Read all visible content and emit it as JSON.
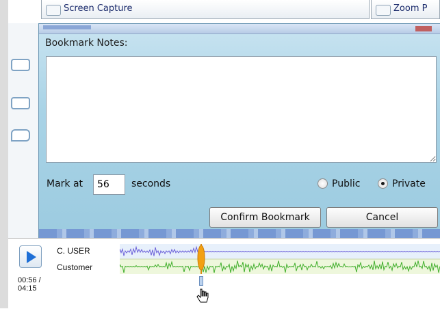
{
  "tabs": [
    {
      "label": "Screen Capture"
    },
    {
      "label": "Zoom P"
    }
  ],
  "dialog": {
    "title": "Bookmark Notes:",
    "notes_value": "",
    "mark_prefix": "Mark at",
    "mark_value": "56",
    "mark_suffix": "seconds",
    "visibility_options": [
      "Public",
      "Private"
    ],
    "visibility_selected": "Private",
    "confirm_label": "Confirm Bookmark",
    "cancel_label": "Cancel"
  },
  "player": {
    "speakers": [
      "C. USER",
      "Customer"
    ],
    "time_current": "00:56 /",
    "time_total": "04:15",
    "playhead_position_seconds": 56,
    "duration_seconds": 255,
    "colors": {
      "agent_wave": "#6a5fd8",
      "customer_wave": "#3fae2a",
      "playhead": "#f2a012",
      "play_icon": "#1e6fd6"
    }
  }
}
